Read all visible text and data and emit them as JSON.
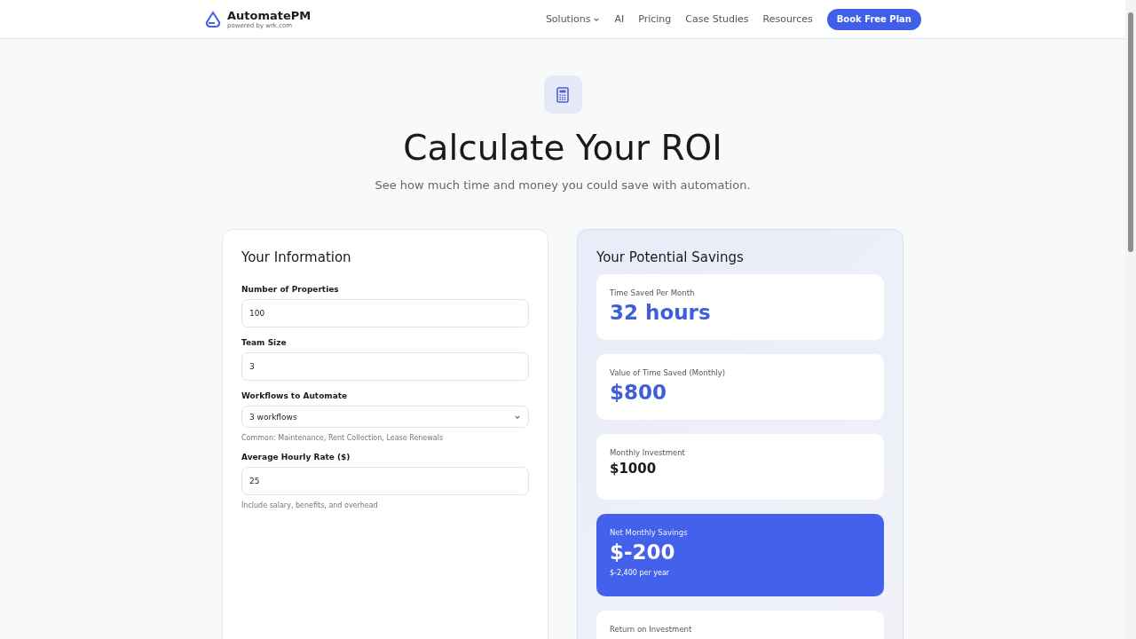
{
  "brand": {
    "name": "AutomatePM",
    "tagline": "powered by wrk.com"
  },
  "nav": [
    {
      "label": "Solutions",
      "dropdown": true
    },
    {
      "label": "AI",
      "dropdown": false
    },
    {
      "label": "Pricing",
      "dropdown": false
    },
    {
      "label": "Case Studies",
      "dropdown": false
    },
    {
      "label": "Resources",
      "dropdown": false
    }
  ],
  "cta": "Book Free Plan",
  "hero": {
    "title": "Calculate Your ROI",
    "subtitle": "See how much time and money you could save with automation."
  },
  "form": {
    "title": "Your Information",
    "fields": [
      {
        "kind": "input",
        "label": "Number of Properties",
        "value": "100"
      },
      {
        "kind": "input",
        "label": "Team Size",
        "value": "3"
      },
      {
        "kind": "select",
        "label": "Workflows to Automate",
        "value": "3 workflows",
        "hint": "Common: Maintenance, Rent Collection, Lease Renewals"
      },
      {
        "kind": "input",
        "label": "Average Hourly Rate ($)",
        "value": "25",
        "hint": "Include salary, benefits, and overhead"
      }
    ]
  },
  "results": {
    "title": "Your Potential Savings",
    "cards": [
      {
        "kind": "accent",
        "label": "Time Saved Per Month",
        "value": "32 hours"
      },
      {
        "kind": "accent",
        "label": "Value of Time Saved (Monthly)",
        "value": "$800"
      },
      {
        "kind": "neutral",
        "label": "Monthly Investment",
        "value": "$1000"
      },
      {
        "kind": "highlight",
        "label": "Net Monthly Savings",
        "value": "$-200",
        "note": "$-2,400 per year"
      },
      {
        "kind": "neutral",
        "label": "Return on Investment"
      }
    ]
  }
}
